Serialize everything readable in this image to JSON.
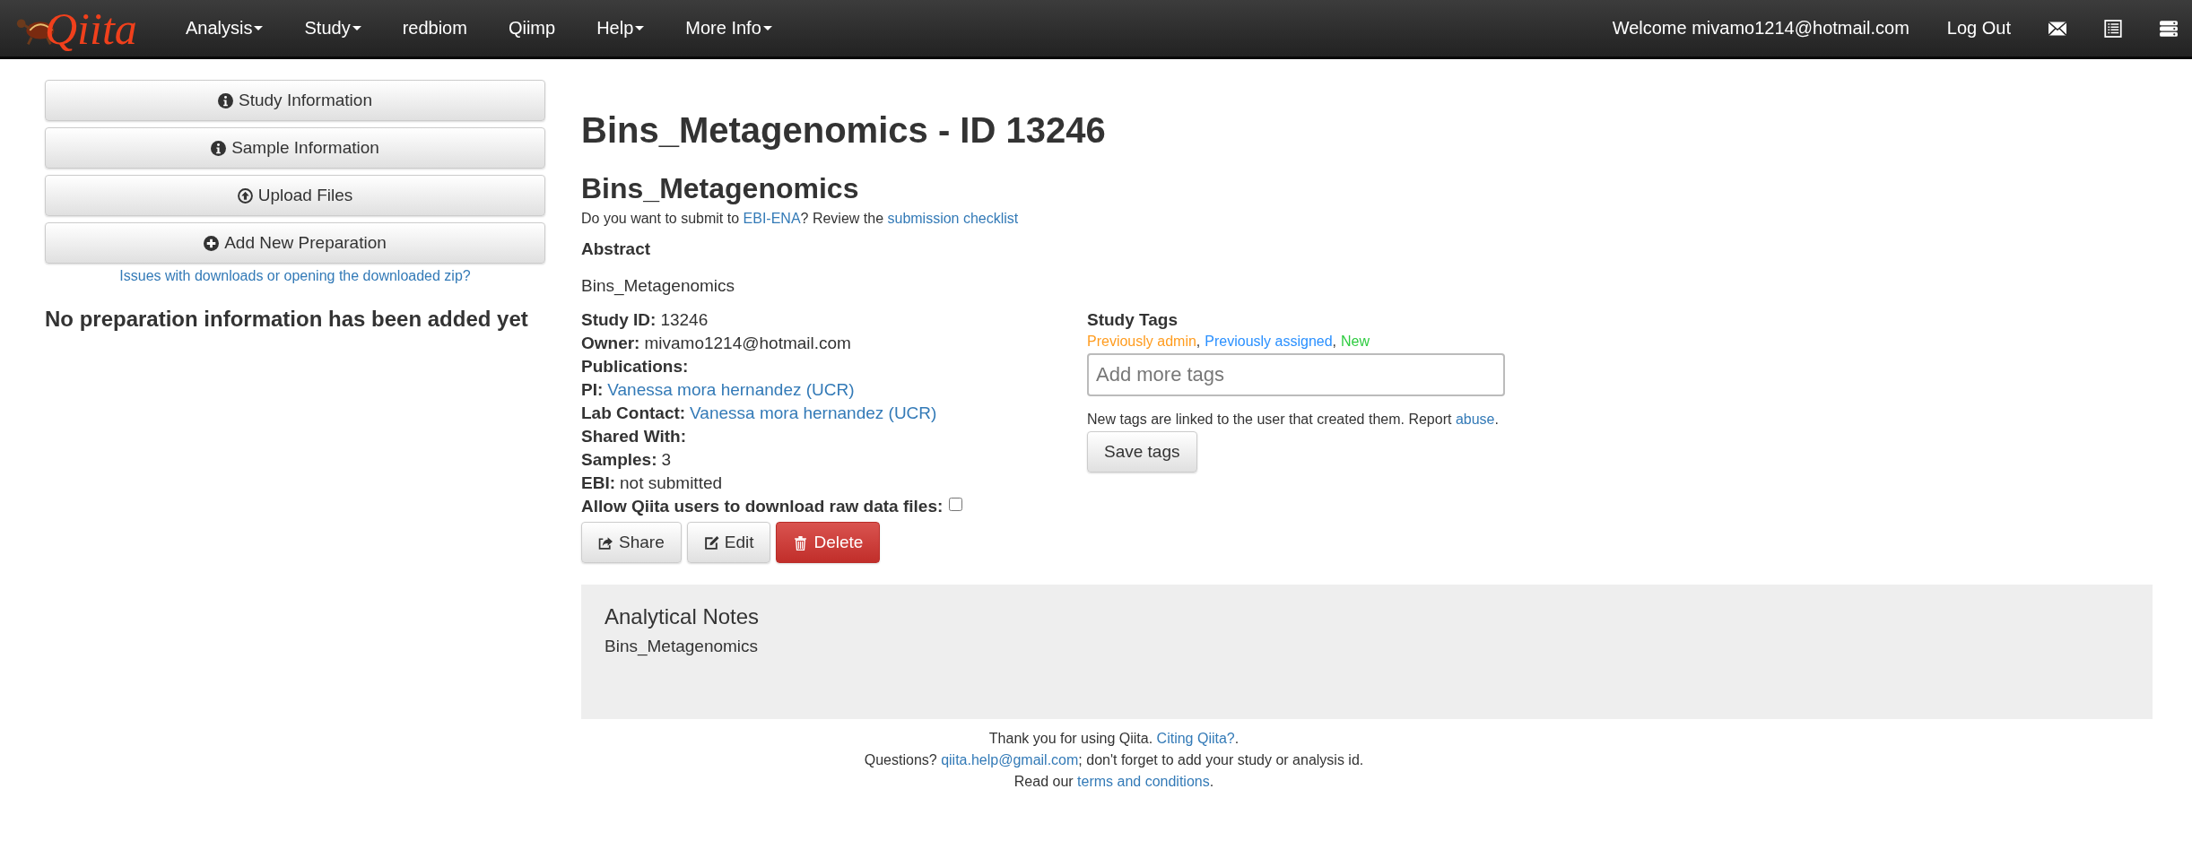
{
  "navbar": {
    "logo": "Qiita",
    "menu": [
      {
        "label": "Analysis",
        "dropdown": true
      },
      {
        "label": "Study",
        "dropdown": true
      },
      {
        "label": "redbiom",
        "dropdown": false
      },
      {
        "label": "Qiimp",
        "dropdown": false
      },
      {
        "label": "Help",
        "dropdown": true
      },
      {
        "label": "More Info",
        "dropdown": true
      }
    ],
    "welcome": "Welcome mivamo1214@hotmail.com",
    "logout": "Log Out",
    "icons": [
      {
        "kind": "envelope"
      },
      {
        "kind": "list"
      },
      {
        "kind": "server"
      }
    ]
  },
  "sidebar": {
    "buttons": [
      "Study Information",
      "Sample Information",
      "Upload Files",
      "Add New Preparation"
    ],
    "help_link": "Issues with downloads or opening the downloaded zip?",
    "empty_message": "No preparation information has been added yet"
  },
  "main": {
    "title": "Bins_Metagenomics - ID 13246",
    "study_title": "Bins_Metagenomics",
    "submit_note": [
      {
        "text": "Do you want to submit to ",
        "kind": "text"
      },
      {
        "text": "EBI-ENA",
        "kind": "link"
      },
      {
        "text": "? Review the ",
        "kind": "text"
      },
      {
        "text": "submission checklist",
        "kind": "link"
      }
    ],
    "abstract_heading": "Abstract",
    "abstract": "Bins_Metagenomics",
    "fields": [
      {
        "label": "Study ID:",
        "value": "13246",
        "kind": "text"
      },
      {
        "label": "Owner:",
        "value": "mivamo1214@hotmail.com",
        "kind": "text"
      },
      {
        "label": "Publications:"
      },
      {
        "label": "PI:",
        "value": "Vanessa mora hernandez (UCR)",
        "kind": "link"
      },
      {
        "label": "Lab Contact:",
        "value": "Vanessa mora hernandez (UCR)",
        "kind": "link"
      },
      {
        "label": "Shared With:"
      },
      {
        "label": "Samples:",
        "value": "3",
        "kind": "text"
      },
      {
        "label": "EBI:",
        "value": "not submitted",
        "kind": "text"
      }
    ],
    "allow_download": {
      "label": "Allow Qiita users to download raw data files:",
      "checked": false
    },
    "actions": [
      {
        "label": "Share",
        "kind": "share"
      },
      {
        "label": "Edit",
        "kind": "edit"
      },
      {
        "label": "Delete",
        "kind": "delete"
      }
    ],
    "tags": {
      "heading": "Study Tags",
      "legend": [
        {
          "text": "Previously admin",
          "color": "#ff9c1f"
        },
        {
          "text": "Previously assigned",
          "color": "#2a90ff"
        },
        {
          "text": "New",
          "color": "#2ecc40"
        }
      ],
      "separator": ",",
      "placeholder": "Add more tags",
      "note": [
        {
          "text": "New tags are linked to the user that created them. Report ",
          "kind": "text"
        },
        {
          "text": "abuse",
          "kind": "link"
        },
        {
          "text": ".",
          "kind": "text"
        }
      ],
      "save": "Save tags"
    },
    "notes": {
      "heading": "Analytical Notes",
      "text": "Bins_Metagenomics"
    }
  },
  "footer": [
    [
      {
        "text": "Thank you for using Qiita. ",
        "kind": "text"
      },
      {
        "text": "Citing Qiita?",
        "kind": "link"
      },
      {
        "text": ".",
        "kind": "text"
      }
    ],
    [
      {
        "text": "Questions? ",
        "kind": "text"
      },
      {
        "text": "qiita.help@gmail.com",
        "kind": "link"
      },
      {
        "text": "; don't forget to add your study or analysis id.",
        "kind": "text"
      }
    ],
    [
      {
        "text": "Read our ",
        "kind": "text"
      },
      {
        "text": "terms and conditions",
        "kind": "link"
      },
      {
        "text": ".",
        "kind": "text"
      }
    ]
  ]
}
